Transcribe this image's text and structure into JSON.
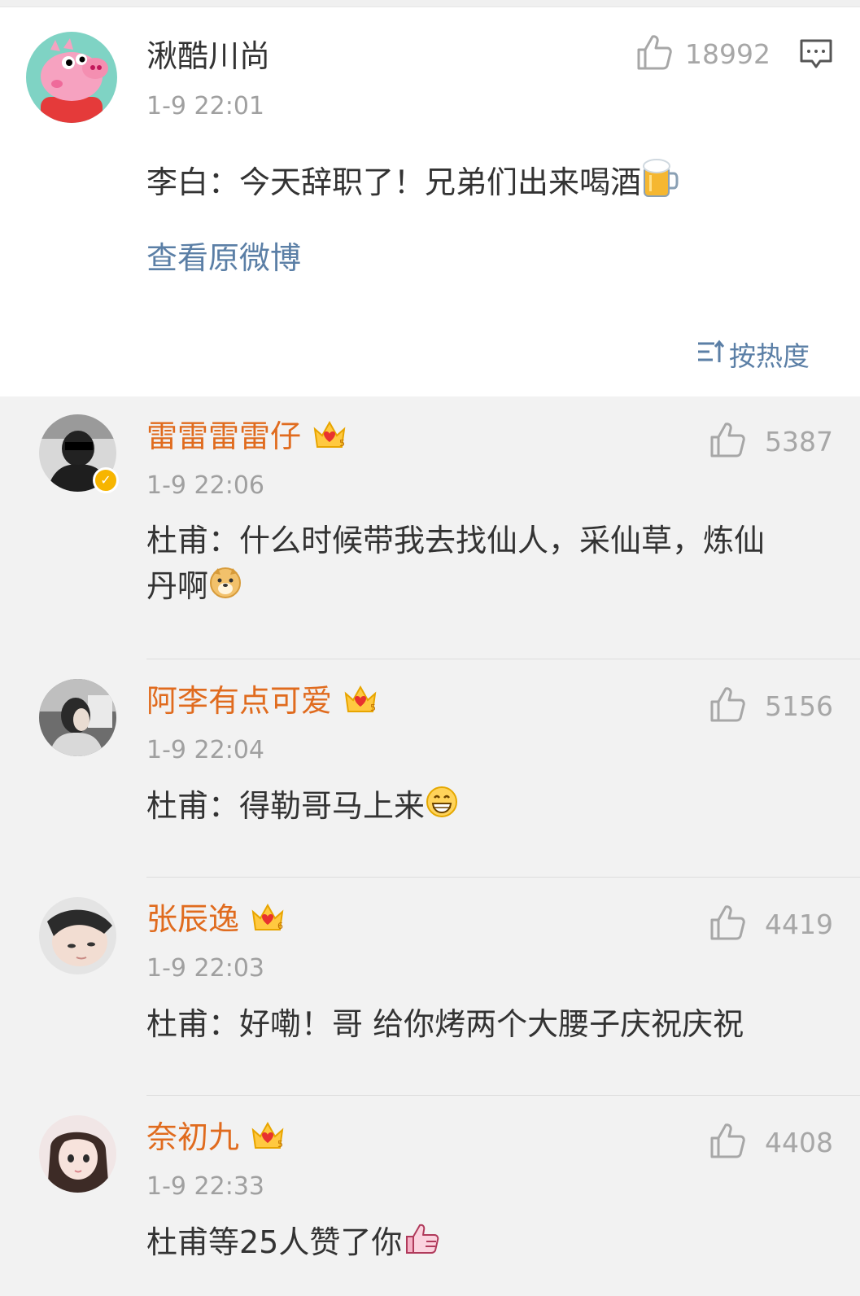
{
  "post": {
    "user": "湫酷川尚",
    "time": "1-9 22:01",
    "likes": "18992",
    "text": "李白：今天辞职了！兄弟们出来喝酒",
    "emoji": "beer-mug-emoji",
    "view_original": "查看原微博"
  },
  "sort": {
    "label": "按热度",
    "icon": "sort-icon"
  },
  "colors": {
    "username": "#e06b1e",
    "link": "#5b7fa6",
    "time": "#a0a0a0",
    "comment_bg": "#f2f2f2"
  },
  "comments": [
    {
      "user": "雷雷雷雷仔",
      "time": "1-9 22:06",
      "likes": "5387",
      "text_line1": "杜甫：什么时候带我去找仙人，采仙草，炼仙",
      "text_line2": "丹啊",
      "emoji": "doge-emoji",
      "verified": true
    },
    {
      "user": "阿李有点可爱",
      "time": "1-9 22:04",
      "likes": "5156",
      "text": "杜甫：得勒哥马上来",
      "emoji": "grin-emoji"
    },
    {
      "user": "张辰逸",
      "time": "1-9 22:03",
      "likes": "4419",
      "text": "杜甫：好嘞！哥 给你烤两个大腰子庆祝庆祝"
    },
    {
      "user": "奈初九",
      "time": "1-9 22:33",
      "likes": "4408",
      "text": "杜甫等25人赞了你",
      "emoji": "thumbs-up-emoji"
    }
  ]
}
